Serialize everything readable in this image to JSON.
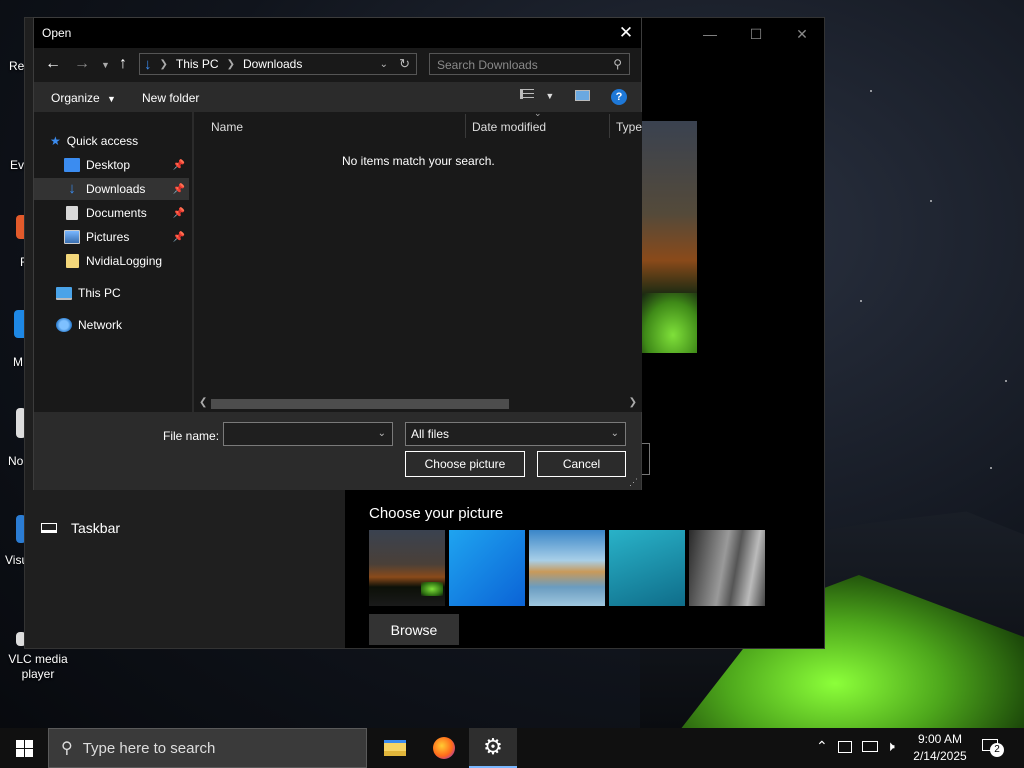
{
  "desktop": {
    "icons": [
      {
        "label": "Rec"
      },
      {
        "label": "Eve"
      },
      {
        "label": "F"
      },
      {
        "label": "M"
      },
      {
        "label": "No"
      },
      {
        "label": "Visu"
      },
      {
        "label": "VLC media player"
      }
    ]
  },
  "settings": {
    "taskbar_label": "Taskbar",
    "choose_picture_title": "Choose your picture",
    "browse_label": "Browse",
    "window_controls": [
      "—",
      "☐",
      "✕"
    ]
  },
  "dialog": {
    "title": "Open",
    "close": "✕",
    "address": {
      "root": "This PC",
      "folder": "Downloads"
    },
    "search_placeholder": "Search Downloads",
    "toolbar": {
      "organize": "Organize",
      "new_folder": "New folder"
    },
    "nav": {
      "quick_access": "Quick access",
      "items": [
        {
          "label": "Desktop",
          "pinned": true
        },
        {
          "label": "Downloads",
          "pinned": true,
          "selected": true
        },
        {
          "label": "Documents",
          "pinned": true
        },
        {
          "label": "Pictures",
          "pinned": true
        },
        {
          "label": "NvidiaLogging",
          "pinned": false
        }
      ],
      "this_pc": "This PC",
      "network": "Network"
    },
    "columns": [
      "Name",
      "Date modified",
      "Type"
    ],
    "empty_message": "No items match your search.",
    "file_name_label": "File name:",
    "file_name_value": "",
    "file_type": "All files",
    "ok_label": "Choose picture",
    "cancel_label": "Cancel"
  },
  "taskbar": {
    "search_placeholder": "Type here to search",
    "apps": [
      "file-explorer",
      "firefox",
      "settings"
    ],
    "clock_time": "9:00 AM",
    "clock_date": "2/14/2025",
    "notification_count": "2"
  },
  "colors": {
    "accent": "#0078d7",
    "dialog_bg": "#2b2b2b",
    "pane_bg": "#191919",
    "tent_green": "#6fd82c"
  }
}
